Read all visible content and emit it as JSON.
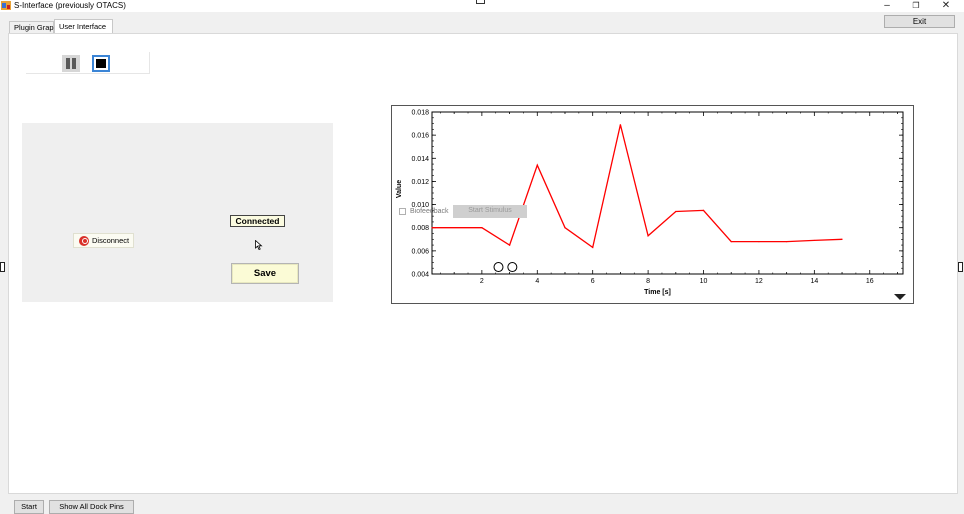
{
  "window": {
    "title": "S-Interface (previously OTACS)",
    "exit_label": "Exit",
    "minimize_glyph": "–",
    "restore_glyph": "❐",
    "close_glyph": "✕"
  },
  "tabs": [
    {
      "label": "Plugin Graph",
      "active": false
    },
    {
      "label": "User Interface",
      "active": true
    }
  ],
  "playback": {
    "pause_icon": "pause-icon",
    "stop_icon": "stop-icon"
  },
  "connection": {
    "disconnect_label": "Disconnect",
    "status": "Connected",
    "save_label": "Save"
  },
  "chart_overlay": {
    "biofeedback_label": "Biofeedback",
    "biofeedback_checked": false,
    "stimulus_label": "Start Stimulus"
  },
  "bottom": {
    "start_label": "Start",
    "dock_pins_label": "Show All Dock Pins"
  },
  "colors": {
    "series": "#ff0000",
    "selected_outline": "#3b85d6",
    "save_bg": "#fbfbd6"
  },
  "chart_data": {
    "type": "line",
    "xlabel": "Time [s]",
    "ylabel": "Value",
    "xlim": [
      0.2,
      17.2
    ],
    "ylim": [
      0.004,
      0.018
    ],
    "xticks": [
      2,
      4,
      6,
      8,
      10,
      12,
      14,
      16
    ],
    "yticks": [
      0.004,
      0.006,
      0.008,
      0.01,
      0.012,
      0.014,
      0.016,
      0.018
    ],
    "ytick_labels": [
      "0.004",
      "0.006",
      "0.008",
      "0.010",
      "0.012",
      "0.014",
      "0.016",
      "0.018"
    ],
    "grid": false,
    "series": [
      {
        "x": [
          0.2,
          2,
          3,
          4,
          5,
          6,
          7,
          8,
          9,
          10,
          11,
          12,
          13,
          14,
          15
        ],
        "y": [
          0.008,
          0.008,
          0.0065,
          0.0134,
          0.008,
          0.0063,
          0.0169,
          0.0073,
          0.0094,
          0.0095,
          0.0068,
          0.0068,
          0.0068,
          0.0069,
          0.007
        ]
      }
    ],
    "markers": [
      {
        "x": 2.6,
        "y": 0.0046
      },
      {
        "x": 3.1,
        "y": 0.0046
      }
    ]
  }
}
